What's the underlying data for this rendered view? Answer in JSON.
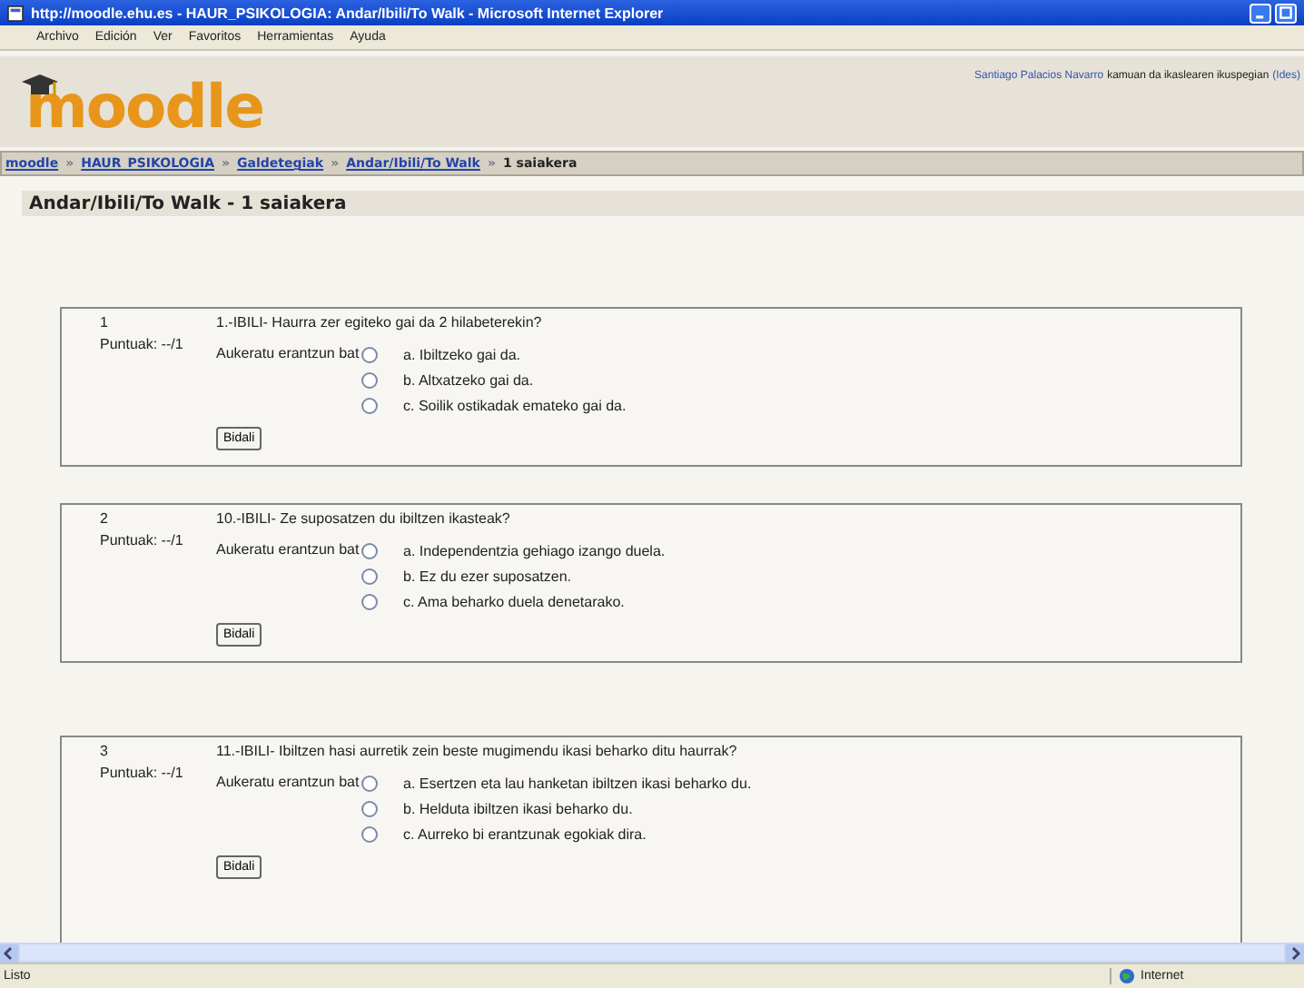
{
  "window": {
    "title": "http://moodle.ehu.es - HAUR_PSIKOLOGIA: Andar/Ibili/To Walk - Microsoft Internet Explorer",
    "menu": [
      "Archivo",
      "Edición",
      "Ver",
      "Favoritos",
      "Herramientas",
      "Ayuda"
    ]
  },
  "header": {
    "logo": "moodle",
    "user_link": "Santiago Palacios Navarro",
    "user_text": "kamuan da ikaslearen ikuspegian",
    "user_action": "(Ides)"
  },
  "breadcrumb_separator": "»",
  "breadcrumb": [
    {
      "label": "moodle",
      "link": true
    },
    {
      "label": "HAUR_PSIKOLOGIA",
      "link": true
    },
    {
      "label": "Galdetegiak",
      "link": true
    },
    {
      "label": "Andar/Ibili/To Walk",
      "link": true
    },
    {
      "label": "1 saiakera",
      "link": false
    }
  ],
  "heading": "Andar/Ibili/To Walk - 1 saiakera",
  "questions": [
    {
      "number": "1",
      "points": "Puntuak: --/1",
      "text": "1.-IBILI- Haurra zer egiteko gai da 2 hilabeterekin?",
      "prompt": "Aukeratu erantzun bat",
      "options": [
        {
          "label": "a. Ibiltzeko gai da.",
          "selected": false
        },
        {
          "label": "b. Altxatzeko gai da.",
          "selected": false
        },
        {
          "label": "c. Soilik ostikadak emateko gai da.",
          "selected": false
        }
      ],
      "button": "Bidali"
    },
    {
      "number": "2",
      "points": "Puntuak: --/1",
      "text": "10.-IBILI- Ze suposatzen du ibiltzen ikasteak?",
      "prompt": "Aukeratu erantzun bat",
      "options": [
        {
          "label": "a. Independentzia gehiago izango duela.",
          "selected": false
        },
        {
          "label": "b. Ez du ezer suposatzen.",
          "selected": false
        },
        {
          "label": "c. Ama beharko duela denetarako.",
          "selected": false
        }
      ],
      "button": "Bidali"
    },
    {
      "number": "3",
      "points": "Puntuak: --/1",
      "text": "11.-IBILI- Ibiltzen hasi aurretik zein beste mugimendu ikasi beharko ditu haurrak?",
      "prompt": "Aukeratu erantzun bat",
      "options": [
        {
          "label": "a. Esertzen eta lau hanketan ibiltzen ikasi beharko du.",
          "selected": false
        },
        {
          "label": "b. Helduta ibiltzen ikasi beharko du.",
          "selected": false
        },
        {
          "label": "c. Aurreko bi erantzunak egokiak dira.",
          "selected": false
        }
      ],
      "button": "Bidali"
    }
  ],
  "status_bar": {
    "text": "Listo",
    "zone": "Internet"
  }
}
